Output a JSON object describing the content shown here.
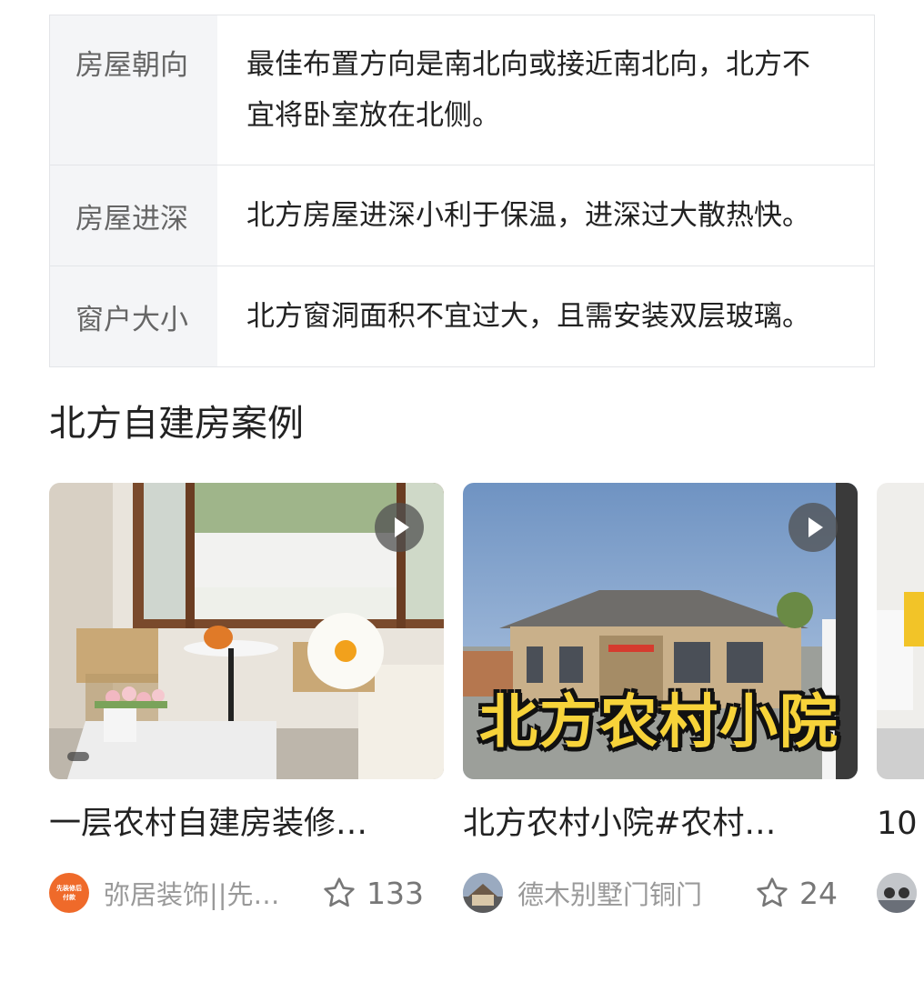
{
  "table": {
    "rows": [
      {
        "key": "房屋朝向",
        "value_line1": "最佳布置方向是南北向或接近南北向，北方不",
        "value_line2": "宜将卧室放在北侧。"
      },
      {
        "key": "房屋进深",
        "value": "北方房屋进深小利于保温，进深过大散热快。"
      },
      {
        "key": "窗户大小",
        "value": "北方窗洞面积不宜过大，且需安装双层玻璃。"
      }
    ]
  },
  "section": {
    "title": "北方自建房案例"
  },
  "cards": [
    {
      "title": "一层农村自建房装修…",
      "author": "弥居装饰||先…",
      "likes": "133",
      "avatar_text": "先装修后付款",
      "thumb_icon": "play-icon"
    },
    {
      "title": "北方农村小院#农村…",
      "author": "德木别墅门铜门",
      "likes": "24",
      "overlay": "北方农村小院",
      "thumb_icon": "play-icon"
    },
    {
      "title": "10"
    }
  ],
  "colors": {
    "table_key_bg": "#f4f5f7",
    "border": "#e3e5e8",
    "overlay_yellow": "#f7d33a",
    "avatar_orange": "#ef6a2a"
  }
}
